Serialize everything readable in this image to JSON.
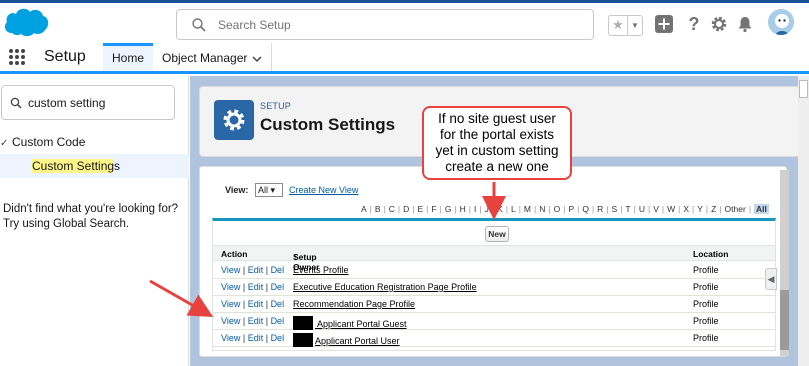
{
  "header": {
    "search_placeholder": "Search Setup",
    "icons": [
      "salesforce-logo",
      "search-icon",
      "star-icon",
      "plus-icon",
      "help-icon",
      "gear-icon",
      "bell-icon",
      "avatar"
    ]
  },
  "context_bar": {
    "app_name": "Setup",
    "tabs": [
      {
        "label": "Home",
        "active": true
      },
      {
        "label": "Object Manager",
        "active": false
      }
    ]
  },
  "left_panel": {
    "quick_find_value": "custom setting",
    "tree_parent": "Custom Code",
    "tree_child_highlight": "Custom Setting",
    "tree_child_rest": "s",
    "not_found_line1": "Didn't find what you're looking for?",
    "not_found_line2": "Try using Global Search."
  },
  "page_header": {
    "eyebrow": "SETUP",
    "title": "Custom Settings"
  },
  "list_view": {
    "view_label": "View:",
    "view_value": "All",
    "create_link": "Create New View",
    "letters": [
      "A",
      "B",
      "C",
      "D",
      "E",
      "F",
      "G",
      "H",
      "I",
      "J",
      "K",
      "L",
      "M",
      "N",
      "O",
      "P",
      "Q",
      "R",
      "S",
      "T",
      "U",
      "V",
      "W",
      "X",
      "Y",
      "Z",
      "Other",
      "All"
    ],
    "selected_letter": "All",
    "new_button": "New",
    "columns": {
      "action": "Action",
      "owner": "Setup Owner",
      "sort_indicator": "↑",
      "location": "Location"
    },
    "action_labels": {
      "view": "View",
      "edit": "Edit",
      "del": "Del"
    },
    "rows": [
      {
        "owner": "Events Profile",
        "location": "Profile",
        "redacted": false
      },
      {
        "owner": "Executive Education Registration Page Profile",
        "location": "Profile",
        "redacted": false
      },
      {
        "owner": "Recommendation Page Profile",
        "location": "Profile",
        "redacted": false
      },
      {
        "owner": " Applicant Portal Guest",
        "location": "Profile",
        "redacted": true
      },
      {
        "owner": "Applicant Portal User",
        "location": "Profile",
        "redacted": true
      }
    ]
  },
  "callout": {
    "lines": [
      "If no site guest user",
      "for the portal exists",
      "yet in custom setting",
      "create a new one"
    ]
  },
  "colors": {
    "brand_blue": "#1b96ff",
    "setup_tile": "#2a67a7",
    "link": "#015ba7",
    "annotation_red": "#e8423f",
    "highlight": "#fcf58a"
  }
}
